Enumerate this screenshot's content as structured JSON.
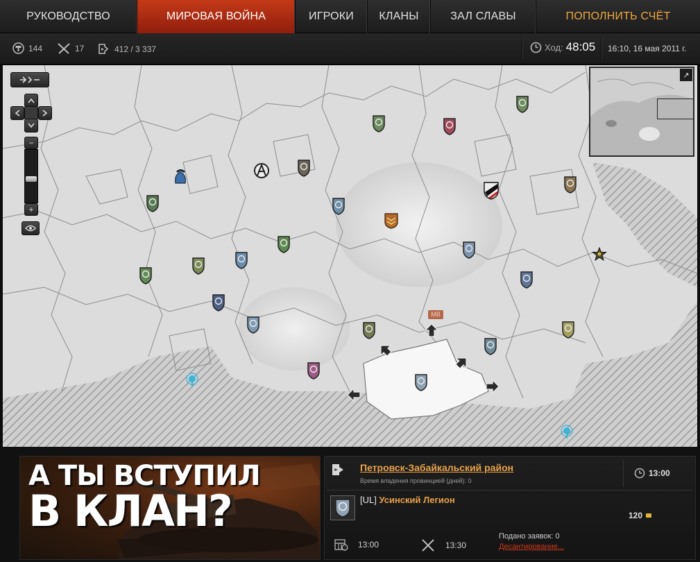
{
  "nav": {
    "items": [
      "Руководство",
      "Мировая война",
      "Игроки",
      "Кланы",
      "Зал славы"
    ],
    "cta": "Пополнить счёт"
  },
  "stats": {
    "tanks": "144",
    "battles": "17",
    "players": "412 / 3 337",
    "turn_label": "Ход:",
    "turn_time": "48:05",
    "datetime": "16:10, 16 мая 2011 г."
  },
  "map": {
    "controls": {
      "zoom_in": "+",
      "zoom_out": "−"
    },
    "minimap_expand": "↗",
    "mb_tag": "MB"
  },
  "banner": {
    "line1": "А ТЫ ВСТУПИЛ",
    "line2": "В КЛАН?"
  },
  "province": {
    "name": "Петровск-Забайкальский район",
    "ownership_label": "Время владения провинцией (дней): 0",
    "time": "13:00"
  },
  "clan": {
    "tag": "[UL]",
    "name": "Усинский Легион",
    "gold": "120"
  },
  "schedule": {
    "prime_time": "13:00",
    "battle_time": "13:30",
    "applications": "Подано заявок: 0",
    "landing_link": "Десантирование..."
  },
  "colors": {
    "accent": "#c43a18",
    "link": "#e8a24a",
    "cta": "#f0a640",
    "danger_link": "#d13a1a"
  }
}
